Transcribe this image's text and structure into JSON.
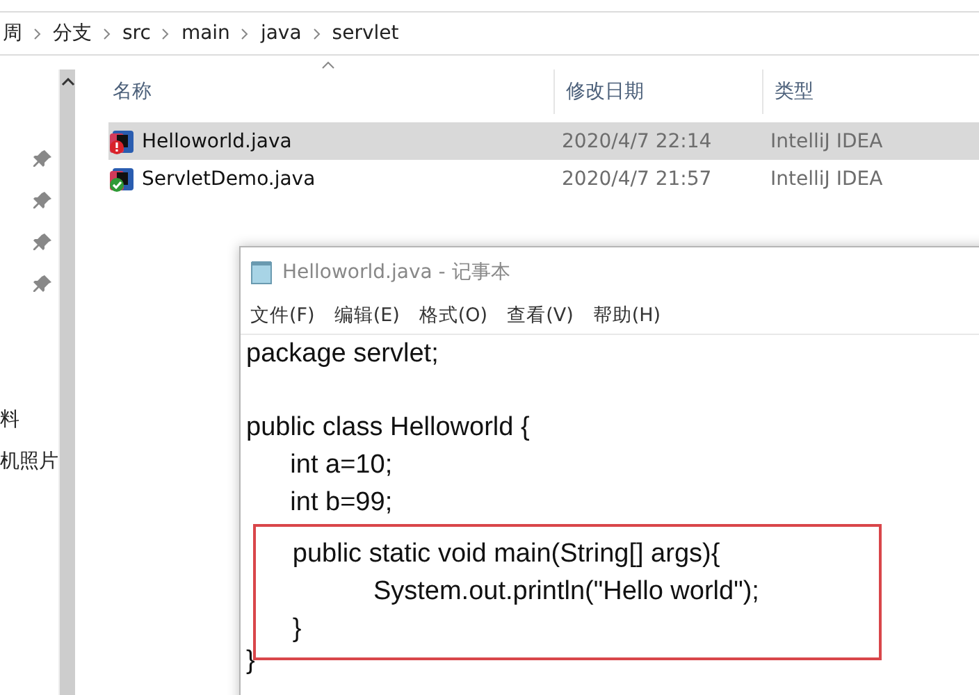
{
  "breadcrumb": [
    "周",
    "分支",
    "src",
    "main",
    "java",
    "servlet"
  ],
  "navigation": {
    "pinned_items": [
      {
        "pinned": true
      },
      {
        "pinned": true
      },
      {
        "pinned": true
      },
      {
        "pinned": true
      }
    ],
    "items": [
      {
        "label": "料"
      },
      {
        "label": "机照片"
      }
    ]
  },
  "file_list": {
    "columns": [
      "名称",
      "修改日期",
      "类型"
    ],
    "rows": [
      {
        "name": "Helloworld.java",
        "modified": "2020/4/7 22:14",
        "type": "IntelliJ IDEA",
        "selected": true,
        "kind": "warning"
      },
      {
        "name": "ServletDemo.java",
        "modified": "2020/4/7 21:57",
        "type": "IntelliJ IDEA",
        "selected": false,
        "kind": "ok"
      }
    ]
  },
  "notepad": {
    "title": "Helloworld.java - 记事本",
    "menu": [
      "文件(F)",
      "编辑(E)",
      "格式(O)",
      "查看(V)",
      "帮助(H)"
    ],
    "paragraphs": [
      [
        "package servlet;"
      ],
      [
        "public class Helloworld {",
        "      int a=10;",
        "      int b=99;"
      ]
    ],
    "highlighted_lines": [
      "     public static void main(String[] args){",
      "                System.out.println(\"Hello world\");",
      "     }"
    ],
    "lines_after": [
      "}"
    ]
  }
}
